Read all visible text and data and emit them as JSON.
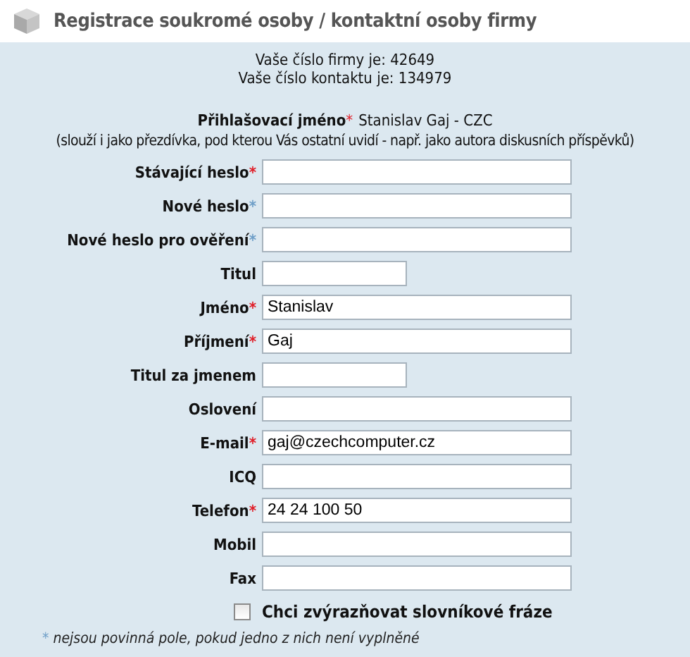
{
  "header": {
    "title": "Registrace soukromé osoby / kontaktní osoby firmy"
  },
  "info": [
    "Vaše číslo firmy je: 42649",
    "Vaše číslo kontaktu je: 134979"
  ],
  "login": {
    "label": "Přihlašovací jméno",
    "mark": {
      "text": "*",
      "color": "#e0202a"
    },
    "value": "Stanislav Gaj - CZC",
    "note": "(slouží i jako přezdívka, pod kterou Vás ostatní uvidí - např. jako autora diskusních příspěvků)"
  },
  "fields": [
    {
      "label": "Stávající heslo",
      "mark": {
        "text": "*",
        "color": "#e0202a"
      },
      "kind": "long"
    },
    {
      "label": "Nové heslo",
      "mark": {
        "text": "*",
        "color": "#6f9fc8"
      },
      "kind": "long"
    },
    {
      "label": "Nové heslo pro ověření",
      "mark": {
        "text": "*",
        "color": "#6f9fc8"
      },
      "kind": "long"
    },
    {
      "label": "Titul",
      "kind": "short"
    },
    {
      "label": "Jméno",
      "mark": {
        "text": "*",
        "color": "#e0202a"
      },
      "kind": "long",
      "value": "Stanislav"
    },
    {
      "label": "Příjmení",
      "mark": {
        "text": "*",
        "color": "#e0202a"
      },
      "kind": "long",
      "value": "Gaj"
    },
    {
      "label": "Titul za jmenem",
      "kind": "short"
    },
    {
      "label": "Oslovení",
      "kind": "long"
    },
    {
      "label": "E-mail",
      "mark": {
        "text": "*",
        "color": "#e0202a"
      },
      "kind": "long",
      "value": "gaj@czechcomputer.cz"
    },
    {
      "label": "ICQ",
      "kind": "long"
    },
    {
      "label": "Telefon",
      "mark": {
        "text": "*",
        "color": "#e0202a"
      },
      "kind": "long",
      "value": "24 24 100 50"
    },
    {
      "label": "Mobil",
      "kind": "long"
    },
    {
      "label": "Fax",
      "kind": "long"
    }
  ],
  "highlight_option": {
    "label": "Chci zvýrazňovat slovníkové fráze",
    "checked": false
  },
  "footnote": {
    "mark": {
      "text": "*",
      "color": "#6f9fc8"
    },
    "text": "nejsou povinná pole, pokud jedno z nich není vyplněné"
  }
}
